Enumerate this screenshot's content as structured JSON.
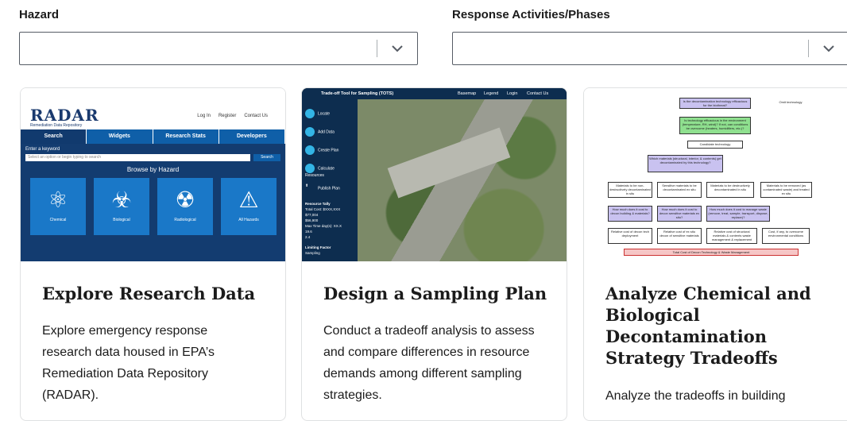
{
  "filters": {
    "hazard": {
      "label": "Hazard",
      "value": ""
    },
    "response": {
      "label": "Response Activities/Phases",
      "value": ""
    }
  },
  "cards": [
    {
      "title": "Explore Research Data",
      "body": "Explore emergency response research data housed in EPA’s Remediation Data Repository (RADAR).",
      "thumb": {
        "logo": "RADAR",
        "tagline": "Remediation Data Repository",
        "top_links": [
          "Log In",
          "Register",
          "Contact Us"
        ],
        "nav": [
          "Search",
          "Widgets",
          "Research Stats",
          "Developers"
        ],
        "keyword_label": "Enter a keyword",
        "search_placeholder": "Select an option or begin typing to search",
        "search_button": "Search",
        "browse_heading": "Browse by Hazard",
        "tiles": [
          "Chemical",
          "Biological",
          "Radiological",
          "All Hazards"
        ]
      }
    },
    {
      "title": "Design a Sampling Plan",
      "body": "Conduct a tradeoff analysis to assess and compare differences in resource demands among different sampling strategies.",
      "thumb": {
        "app_title": "Trade-off Tool for Sampling (TOTS)",
        "header_links": [
          "Basemap",
          "Legend",
          "Login",
          "Contact Us"
        ],
        "steps": [
          "Locate",
          "Add Data",
          "Create Plan",
          "Calculate Resources",
          "Publish Plan"
        ],
        "tally_title": "Resource Tally",
        "tally_lines": [
          "Total Cost: $XXX,XXX",
          "$77,004",
          "$56,900",
          "Max Time day(s): XX.X",
          "19.6",
          "2.4"
        ],
        "limiting_factor": "Limiting Factor",
        "limiting_value": "Sampling"
      }
    },
    {
      "title": "Analyze Chemical and Biological Decontamination Strategy Tradeoffs",
      "body": "Analyze the tradeoffs in building",
      "thumb": {
        "q1": "Is the decontamination technology efficacious for the biothreat?",
        "q1_no": "Omit technology",
        "q2": "Is technology efficacious in the environment (temperature, RH, wind)? If not, can conditions be overcome (heaters, humidifiers, etc.)?",
        "candidate": "Candidate technology",
        "which": "Which materials (structural, interior, & contents) get decontaminated by this technology?",
        "row1": [
          "Materials to be non-destructively decontaminated in situ",
          "Sensitive materials to be decontaminated ex situ",
          "Materials to be destructively decontaminated in situ",
          "Materials to be removed (as contaminated waste) and treated ex situ"
        ],
        "row2": [
          "How much does it cost to decon building & materials?",
          "How much does it cost to decon sensitive materials ex situ?",
          "How much does it cost to manage waste (remove, treat, sample, transport, dispose, replace)?"
        ],
        "row3": [
          "Relative cost of decon tech deployment",
          "Relative cost of ex situ decon of sensitive materials",
          "Relative cost of structural materials & contents waste management & replacement",
          "Cost, if any, to overcome environmental conditions"
        ],
        "total": "Total Cost of Decon Technology & Waste Management"
      }
    }
  ]
}
